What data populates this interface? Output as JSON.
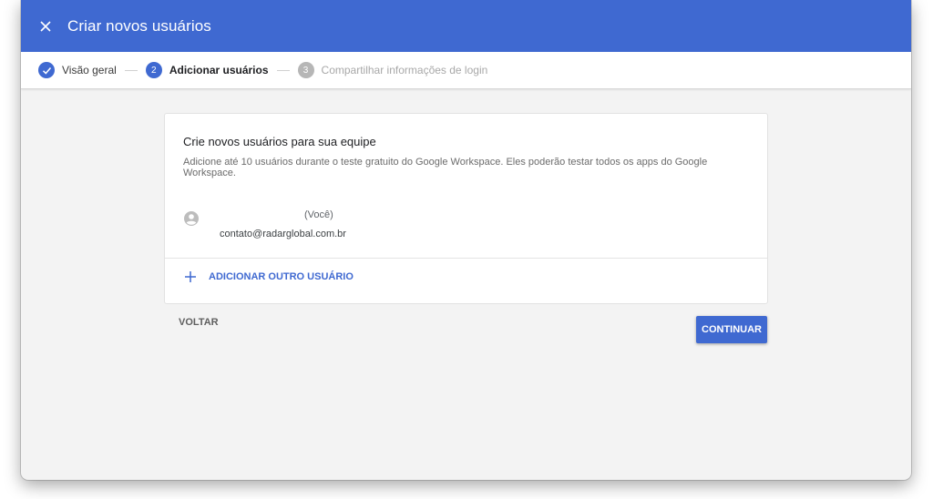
{
  "header": {
    "title": "Criar novos usuários",
    "close_icon": "close-icon",
    "accent": "#3f69d1"
  },
  "stepper": {
    "steps": [
      {
        "number": "1",
        "label": "Visão geral",
        "state": "done",
        "icon": "check-icon"
      },
      {
        "number": "2",
        "label": "Adicionar usuários",
        "state": "active"
      },
      {
        "number": "3",
        "label": "Compartilhar informações de login",
        "state": "pending"
      }
    ]
  },
  "card": {
    "title": "Crie novos usuários para sua equipe",
    "description": "Adicione até 10 usuários durante o teste gratuito do Google Workspace. Eles poderão testar todos os apps do Google Workspace.",
    "user": {
      "avatar_icon": "account-circle-icon",
      "you_label": "(Você)",
      "email": "contato@radarglobal.com.br"
    },
    "add_user_label": "ADICIONAR OUTRO USUÁRIO",
    "add_icon": "plus-icon"
  },
  "actions": {
    "back_label": "VOLTAR",
    "continue_label": "CONTINUAR"
  }
}
